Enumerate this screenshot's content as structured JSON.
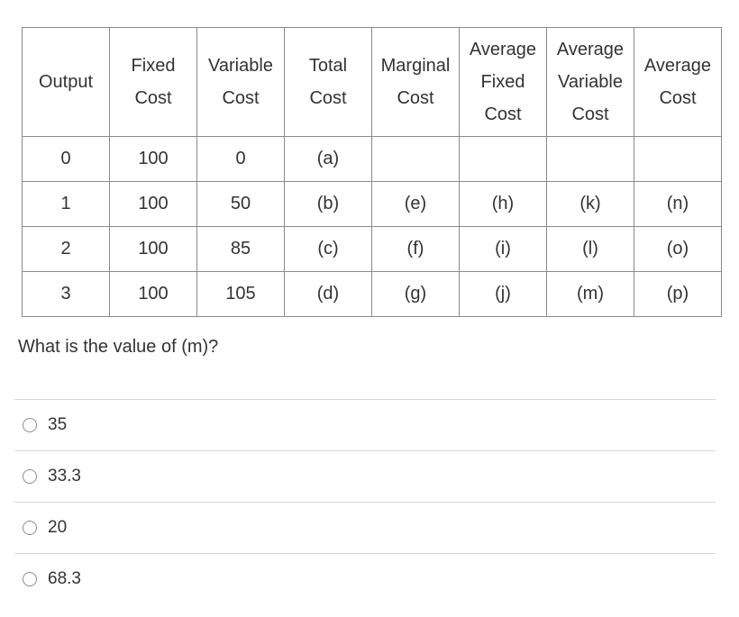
{
  "table": {
    "headers": [
      [
        "Output"
      ],
      [
        "Fixed",
        "Cost"
      ],
      [
        "Variable",
        "Cost"
      ],
      [
        "Total",
        "Cost"
      ],
      [
        "Marginal",
        "Cost"
      ],
      [
        "Average",
        "Fixed",
        "Cost"
      ],
      [
        "Average",
        "Variable",
        "Cost"
      ],
      [
        "Average",
        "Cost"
      ]
    ],
    "rows": [
      [
        "0",
        "100",
        "0",
        "(a)",
        "",
        "",
        "",
        ""
      ],
      [
        "1",
        "100",
        "50",
        "(b)",
        "(e)",
        "(h)",
        "(k)",
        "(n)"
      ],
      [
        "2",
        "100",
        "85",
        "(c)",
        "(f)",
        "(i)",
        "(l)",
        "(o)"
      ],
      [
        "3",
        "100",
        "105",
        "(d)",
        "(g)",
        "(j)",
        "(m)",
        "(p)"
      ]
    ]
  },
  "question": {
    "text": "What is the value of (m)?"
  },
  "options": [
    {
      "label": "35"
    },
    {
      "label": "33.3"
    },
    {
      "label": "20"
    },
    {
      "label": "68.3"
    }
  ]
}
